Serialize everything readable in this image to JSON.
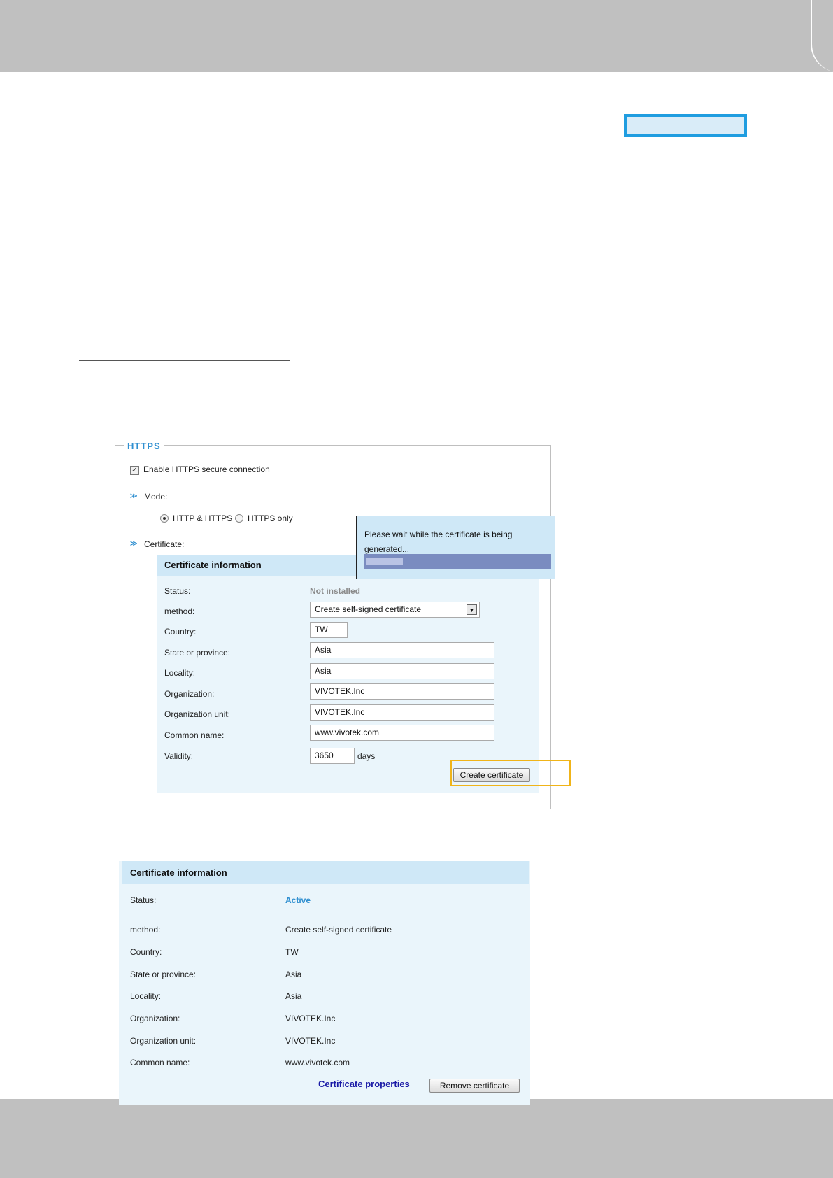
{
  "https": {
    "title": "HTTPS",
    "enable_label": "Enable HTTPS secure connection",
    "enable_checked": true,
    "mode_label": "Mode:",
    "mode_options": [
      "HTTP & HTTPS",
      "HTTPS only"
    ],
    "mode_selected": "HTTP & HTTPS",
    "certificate_label": "Certificate:",
    "check_glyph": "✓",
    "chevron_glyph": "≫"
  },
  "cert_form": {
    "header": "Certificate information",
    "rows": [
      {
        "label": "Status:",
        "value": "Not installed"
      },
      {
        "label": "method:",
        "value": "Create self-signed certificate"
      },
      {
        "label": "Country:",
        "value": "TW"
      },
      {
        "label": "State or province:",
        "value": "Asia"
      },
      {
        "label": "Locality:",
        "value": "Asia"
      },
      {
        "label": "Organization:",
        "value": "VIVOTEK.Inc"
      },
      {
        "label": "Organization unit:",
        "value": "VIVOTEK.Inc"
      },
      {
        "label": "Common name:",
        "value": "www.vivotek.com"
      },
      {
        "label": "Validity:",
        "value": "3650"
      }
    ],
    "validity_unit": "days",
    "create_button": "Create certificate"
  },
  "popup": {
    "message": "Please wait while the certificate is being generated...",
    "progress": 0.2
  },
  "cert_info": {
    "header": "Certificate information",
    "rows": [
      {
        "label": "Status:",
        "value": "Active"
      },
      {
        "label": "method:",
        "value": "Create self-signed certificate"
      },
      {
        "label": "Country:",
        "value": "TW"
      },
      {
        "label": "State or province:",
        "value": "Asia"
      },
      {
        "label": "Locality:",
        "value": "Asia"
      },
      {
        "label": "Organization:",
        "value": "VIVOTEK.Inc"
      },
      {
        "label": "Organization unit:",
        "value": "VIVOTEK.Inc"
      },
      {
        "label": "Common name:",
        "value": "www.vivotek.com"
      }
    ],
    "properties_link": "Certificate properties",
    "remove_button": "Remove certificate"
  }
}
